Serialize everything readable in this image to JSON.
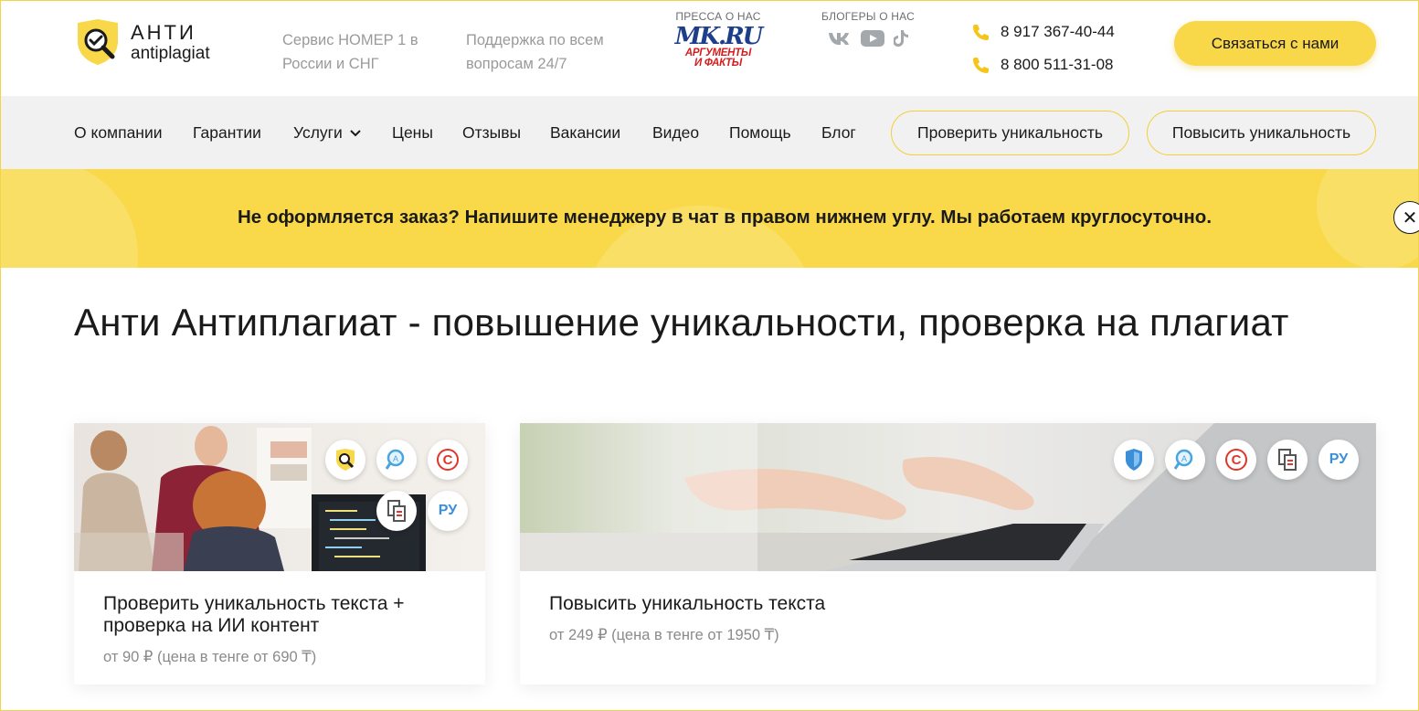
{
  "header": {
    "logo_title": "АНТИ",
    "logo_subtitle": "antiplagiat",
    "tagline1": "Сервис НОМЕР 1 в России и СНГ",
    "tagline2": "Поддержка по всем вопросам 24/7",
    "press_label": "ПРЕССА О НАС",
    "press_logo1": "MK.RU",
    "press_logo2_line1": "Аргументы",
    "press_logo2_line2": "и Факты",
    "bloggers_label": "БЛОГЕРЫ О НАС",
    "social_icons": [
      "vk-icon",
      "youtube-icon",
      "tiktok-icon"
    ],
    "phone1": "8 917 367-40-44",
    "phone2": "8 800 511-31-08",
    "contact_button": "Связаться с нами"
  },
  "nav": {
    "items": [
      "О компании",
      "Гарантии",
      "Услуги",
      "Цены",
      "Отзывы",
      "Вакансии",
      "Видео",
      "Помощь",
      "Блог"
    ],
    "check_button": "Проверить уникальность",
    "raise_button": "Повысить уникальность"
  },
  "banner": {
    "text": "Не оформляется заказ? Напишите менеджеру в чат в правом нижнем углу. Мы работаем круглосуточно.",
    "close_symbol": "✕"
  },
  "main": {
    "title": "Анти Антиплагиат - повышение уникальности, проверка на плагиат",
    "cards": [
      {
        "title": "Проверить уникальность текста + проверка на ИИ контент",
        "price": "от 90 ₽ (цена в тенге от 690 ₸)",
        "badges": [
          "antiplagiat-icon",
          "search-icon",
          "copyright-icon",
          "document-icon",
          "РУ"
        ]
      },
      {
        "title": "Повысить уникальность текста",
        "price": "от 249 ₽ (цена в тенге от 1950 ₸)",
        "badges": [
          "shield-icon",
          "search-icon",
          "copyright-icon",
          "document-icon",
          "РУ"
        ]
      }
    ]
  },
  "colors": {
    "accent": "#f8d748",
    "banner": "#f9d94a",
    "nav_bg": "#f1f1f1",
    "muted_text": "#9a9a9a",
    "ru_badge": "#3a8fd8",
    "copyright_red": "#e0352b"
  }
}
